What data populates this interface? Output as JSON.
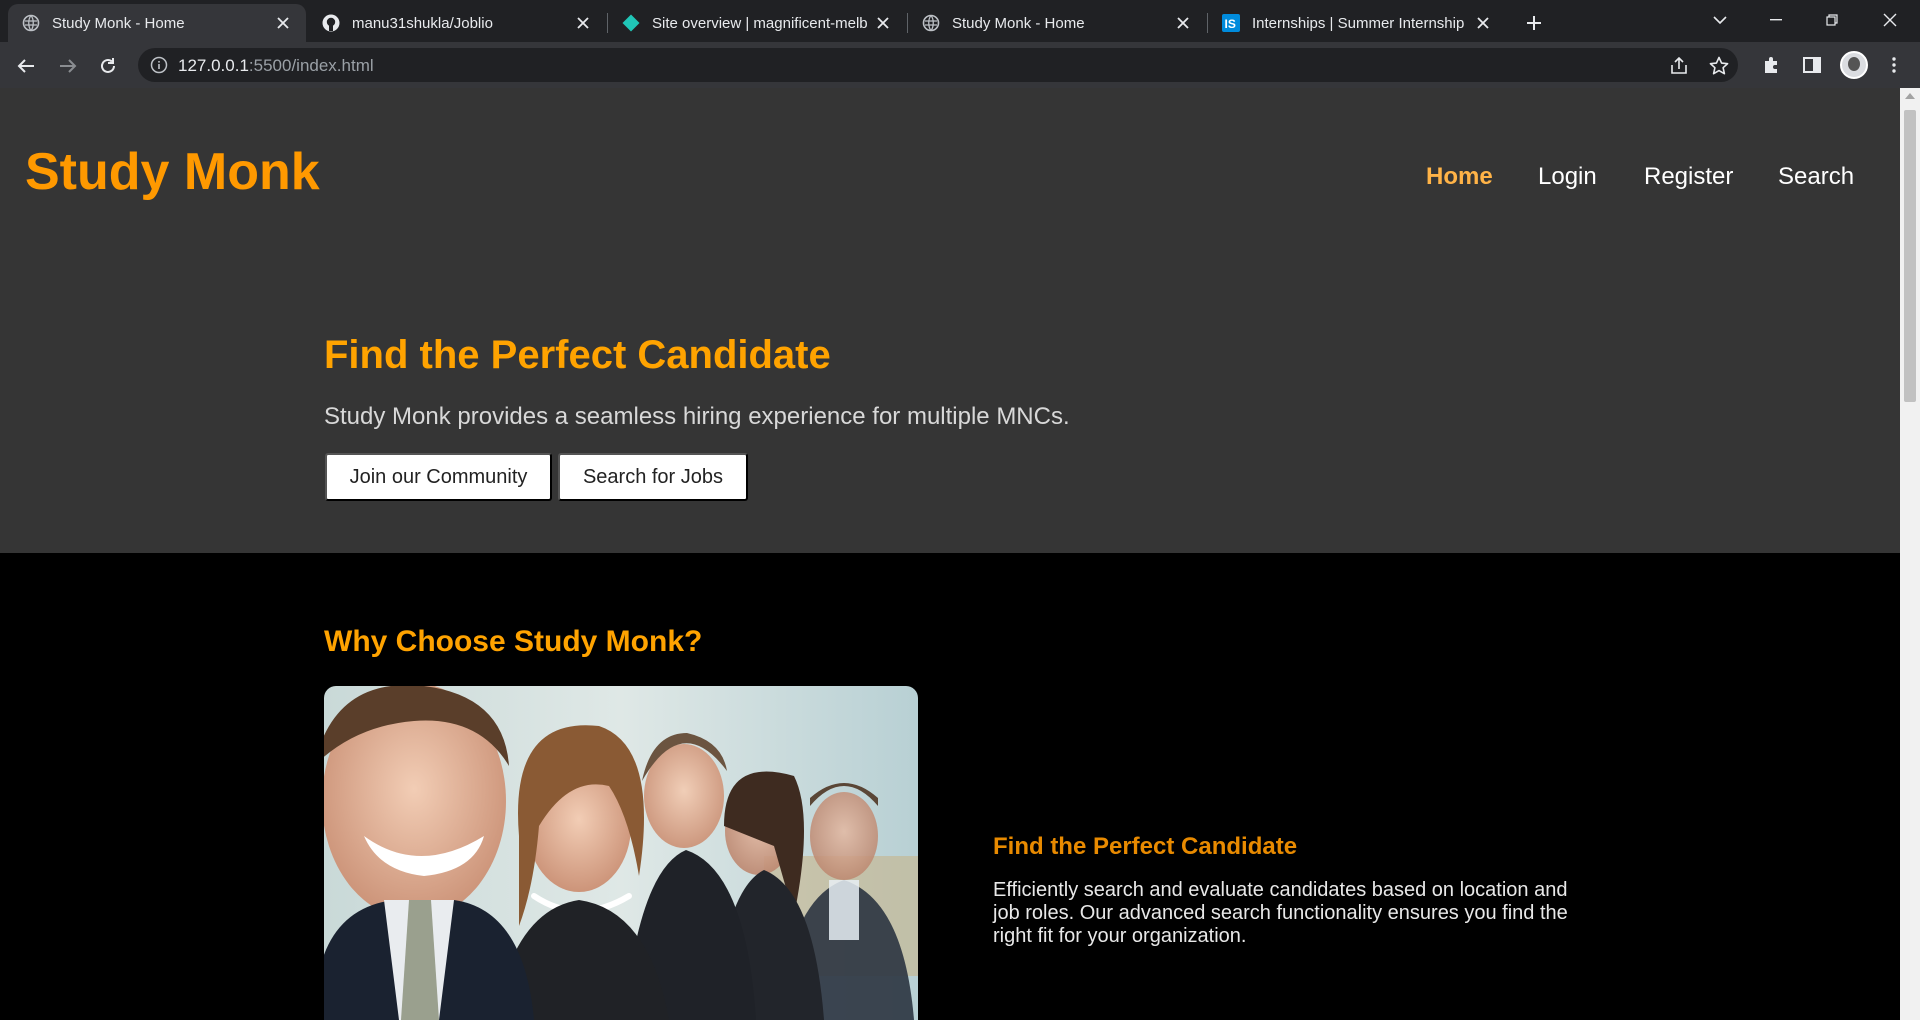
{
  "browser": {
    "tabs": [
      {
        "title": "Study Monk - Home",
        "icon": "globe-icon",
        "active": true
      },
      {
        "title": "manu31shukla/Joblio",
        "icon": "github-icon",
        "active": false
      },
      {
        "title": "Site overview | magnificent-melb",
        "icon": "netlify-icon",
        "active": false
      },
      {
        "title": "Study Monk - Home",
        "icon": "globe-icon",
        "active": false
      },
      {
        "title": "Internships | Summer Internship",
        "icon": "internshala-icon",
        "active": false
      }
    ],
    "url_host": "127.0.0.1",
    "url_rest": ":5500/index.html"
  },
  "site": {
    "brand": "Study Monk",
    "nav": [
      "Home",
      "Login",
      "Register",
      "Search"
    ],
    "hero": {
      "title": "Find the Perfect Candidate",
      "subtitle": "Study Monk provides a seamless hiring experience for multiple MNCs.",
      "buttons": [
        "Join our Community",
        "Search for Jobs"
      ]
    },
    "why": {
      "title": "Why Choose Study Monk?",
      "feature_title": "Find the Perfect Candidate",
      "feature_text": "Efficiently search and evaluate candidates based on location and job roles. Our advanced search functionality ensures you find the right fit for your organization."
    }
  },
  "colors": {
    "accent": "#ff9900",
    "hero_bg": "#353535",
    "section_bg": "#000000"
  }
}
